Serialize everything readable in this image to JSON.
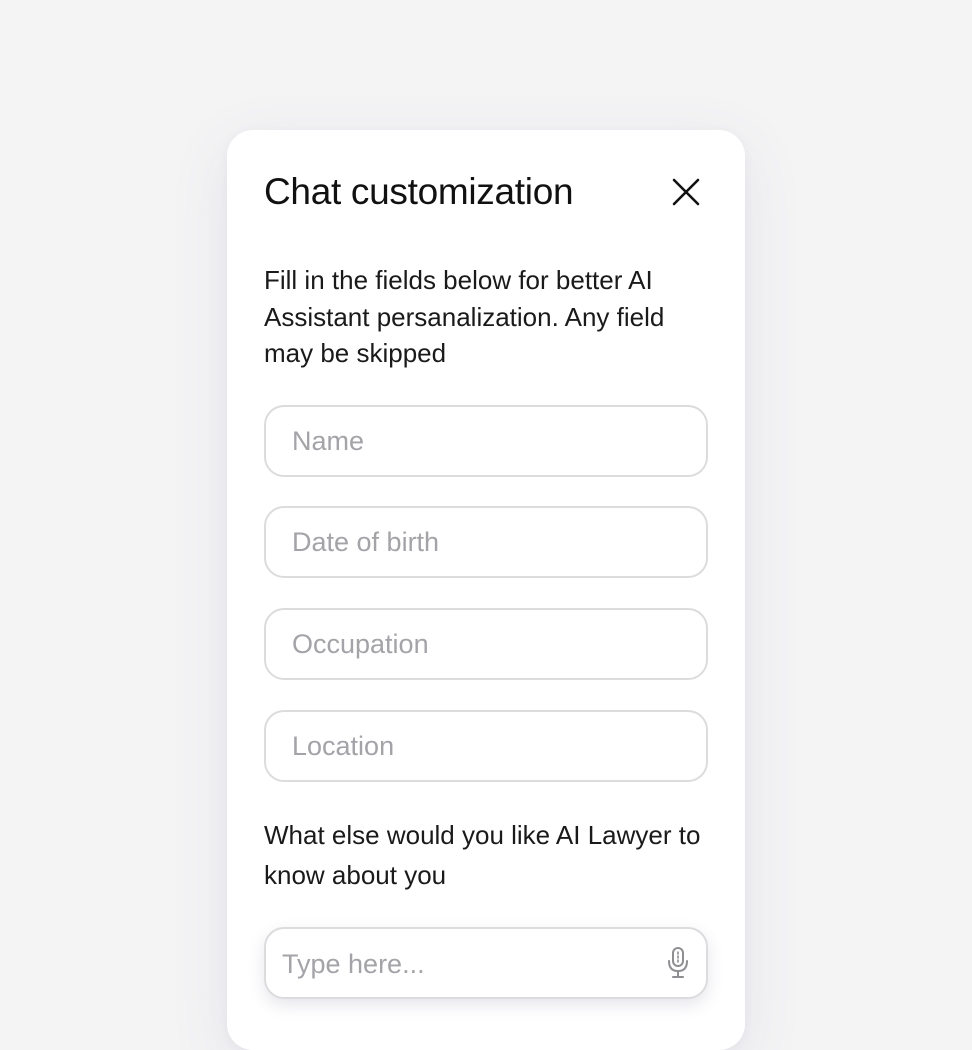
{
  "dialog": {
    "title": "Chat customization",
    "close_icon": "close-icon",
    "intro": "Fill in the fields below for better AI Assistant persanalization. Any field may be skipped"
  },
  "fields": {
    "name_placeholder": "Name",
    "dob_placeholder": "Date of birth",
    "occupation_placeholder": "Occupation",
    "location_placeholder": "Location"
  },
  "about": {
    "question": "What else would you like AI Lawyer to know about you",
    "placeholder": "Type here...",
    "mic_icon": "microphone-icon"
  },
  "colors": {
    "background": "#f4f4f5",
    "card": "#ffffff",
    "text": "#111111",
    "placeholder": "#a3a3a8",
    "border": "#dcdcdf"
  }
}
